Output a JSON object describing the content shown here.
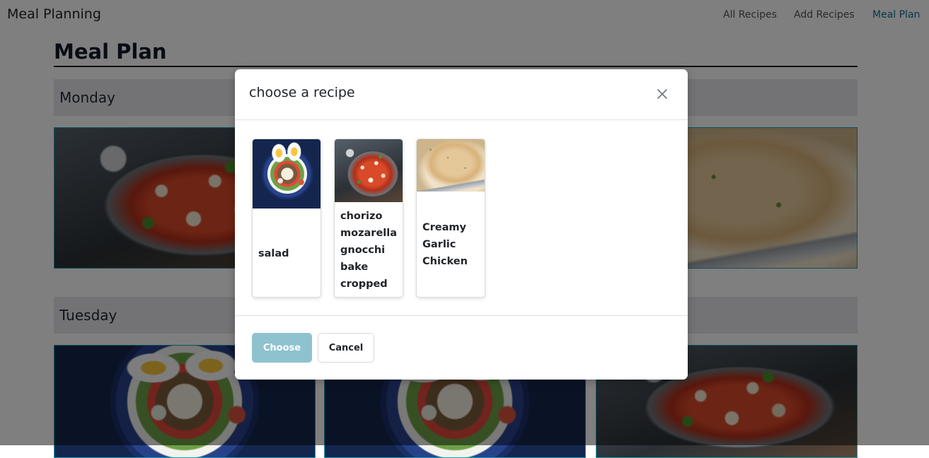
{
  "navbar": {
    "brand": "Meal Planning",
    "links": [
      {
        "label": "All Recipes"
      },
      {
        "label": "Add Recipes"
      },
      {
        "label": "Meal Plan"
      }
    ]
  },
  "page": {
    "title": "Meal Plan",
    "days": [
      {
        "name": "Monday"
      },
      {
        "name": "Tuesday"
      }
    ]
  },
  "modal": {
    "title": "choose a recipe",
    "close_icon": "close-icon",
    "recipes": [
      {
        "label": "salad",
        "image": "salad-photo"
      },
      {
        "label": "chorizo mozarella gnocchi bake cropped",
        "image": "gnocchi-bake-photo"
      },
      {
        "label": "Creamy Garlic Chicken",
        "image": "creamy-garlic-chicken-photo"
      }
    ],
    "choose_label": "Choose",
    "cancel_label": "Cancel"
  },
  "colors": {
    "accent": "#0d6e8a",
    "choose_button": "#8fc2cf",
    "image_border": "#17a2b8"
  }
}
